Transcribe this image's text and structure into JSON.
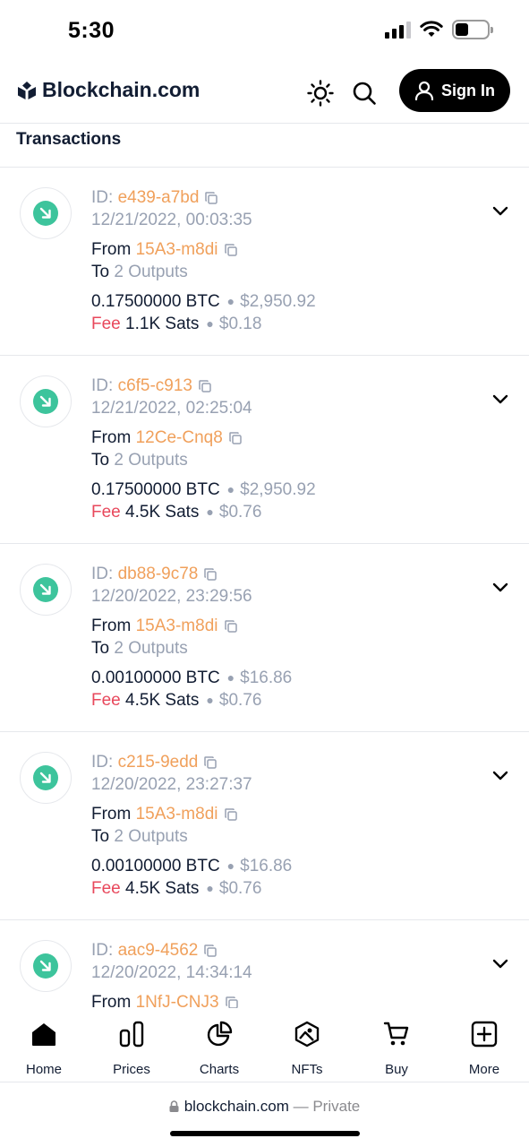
{
  "status_bar": {
    "time": "5:30"
  },
  "header": {
    "brand": "Blockchain.com",
    "sign_in_label": "Sign In",
    "icons": [
      "sun-icon",
      "search-icon",
      "user-icon"
    ]
  },
  "section": {
    "title": "Transactions"
  },
  "transactions": [
    {
      "id_label": "ID:",
      "id": "e439-a7bd",
      "datetime": "12/21/2022, 00:03:35",
      "from_label": "From",
      "from": "15A3-m8di",
      "to_label": "To",
      "to": "2 Outputs",
      "amount": "0.17500000 BTC",
      "amount_usd": "$2,950.92",
      "fee_label": "Fee",
      "fee": "1.1K Sats",
      "fee_usd": "$0.18"
    },
    {
      "id_label": "ID:",
      "id": "c6f5-c913",
      "datetime": "12/21/2022, 02:25:04",
      "from_label": "From",
      "from": "12Ce-Cnq8",
      "to_label": "To",
      "to": "2 Outputs",
      "amount": "0.17500000 BTC",
      "amount_usd": "$2,950.92",
      "fee_label": "Fee",
      "fee": "4.5K Sats",
      "fee_usd": "$0.76"
    },
    {
      "id_label": "ID:",
      "id": "db88-9c78",
      "datetime": "12/20/2022, 23:29:56",
      "from_label": "From",
      "from": "15A3-m8di",
      "to_label": "To",
      "to": "2 Outputs",
      "amount": "0.00100000 BTC",
      "amount_usd": "$16.86",
      "fee_label": "Fee",
      "fee": "4.5K Sats",
      "fee_usd": "$0.76"
    },
    {
      "id_label": "ID:",
      "id": "c215-9edd",
      "datetime": "12/20/2022, 23:27:37",
      "from_label": "From",
      "from": "15A3-m8di",
      "to_label": "To",
      "to": "2 Outputs",
      "amount": "0.00100000 BTC",
      "amount_usd": "$16.86",
      "fee_label": "Fee",
      "fee": "4.5K Sats",
      "fee_usd": "$0.76"
    },
    {
      "id_label": "ID:",
      "id": "aac9-4562",
      "datetime": "12/20/2022, 14:34:14",
      "from_label": "From",
      "from": "1NfJ-CNJ3",
      "to_label": "",
      "to": "",
      "amount": "",
      "amount_usd": "",
      "fee_label": "",
      "fee": "",
      "fee_usd": ""
    }
  ],
  "bottom_nav": [
    {
      "label": "Home",
      "icon": "home-icon"
    },
    {
      "label": "Prices",
      "icon": "prices-icon"
    },
    {
      "label": "Charts",
      "icon": "charts-icon"
    },
    {
      "label": "NFTs",
      "icon": "nfts-icon"
    },
    {
      "label": "Buy",
      "icon": "cart-icon"
    },
    {
      "label": "More",
      "icon": "plus-icon"
    }
  ],
  "browser": {
    "domain": "blockchain.com",
    "suffix": "— Private"
  },
  "colors": {
    "accent_orange": "#f0a05b",
    "received_green": "#3dc49c",
    "fee_red": "#e8485c"
  }
}
